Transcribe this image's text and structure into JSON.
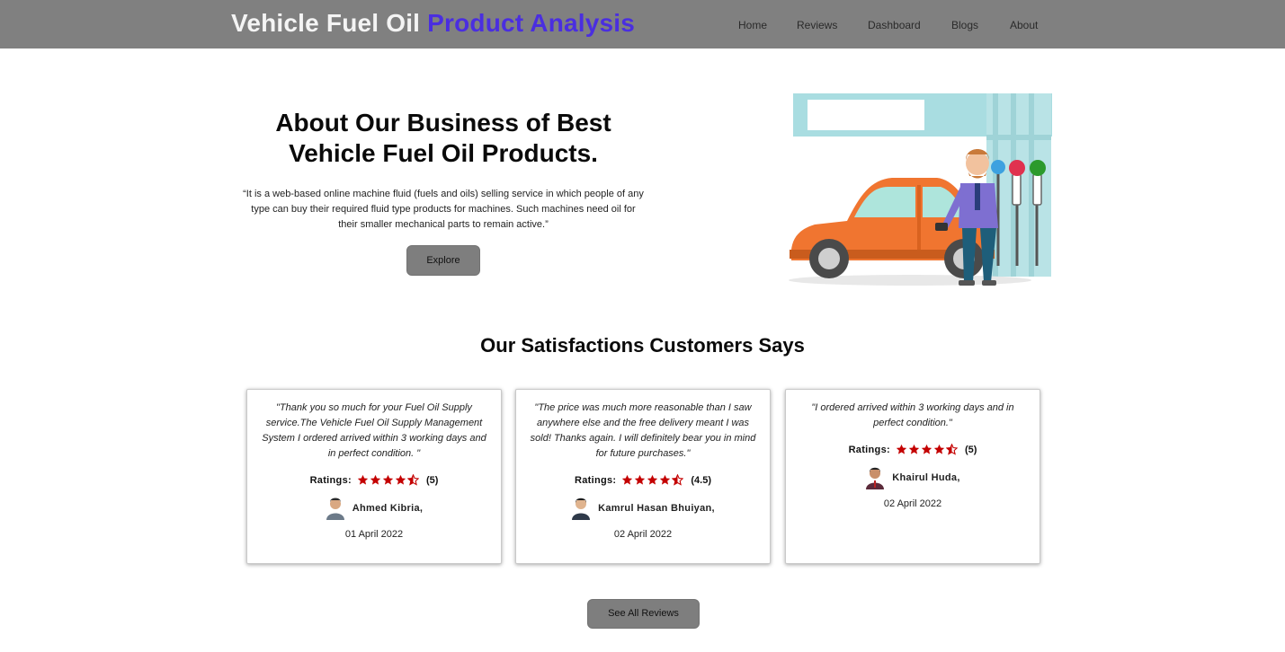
{
  "navbar": {
    "brand_part1": "Vehicle Fuel Oil",
    "brand_part2": "Product Analysis",
    "links": [
      "Home",
      "Reviews",
      "Dashboard",
      "Blogs",
      "About"
    ]
  },
  "hero": {
    "title_line1": "About Our Business of Best",
    "title_line2": "Vehicle Fuel Oil Products.",
    "description": "“It is a web-based online machine fluid (fuels and oils) selling service in which people of any type can buy their required fluid type products for machines. Such machines need oil for their smaller mechanical parts to remain active.”",
    "explore_label": "Explore",
    "illustration": "fuel-station-car-illustration"
  },
  "reviews": {
    "section_title": "Our Satisfactions Customers Says",
    "ratings_label": "Ratings:",
    "items": [
      {
        "quote": "\"Thank you so much for your Fuel Oil Supply service.The Vehicle Fuel Oil Supply Management System I ordered arrived within 3 working days and in perfect condition. \"",
        "rating_text": "(5)",
        "stars": 4.5,
        "author": "Ahmed Kibria,",
        "date": "01 April 2022"
      },
      {
        "quote": "\"The price was much more reasonable than I saw anywhere else and the free delivery meant I was sold! Thanks again. I will definitely bear you in mind for future purchases.\"",
        "rating_text": "(4.5)",
        "stars": 4.5,
        "author": "Kamrul Hasan Bhuiyan,",
        "date": "02 April 2022"
      },
      {
        "quote": "\"I ordered arrived within 3 working days and in perfect condition.\"",
        "rating_text": "(5)",
        "stars": 4.5,
        "author": "Khairul Huda,",
        "date": "02 April 2022"
      }
    ],
    "see_all_label": "See All Reviews"
  },
  "colors": {
    "navbar_bg": "#808080",
    "brand_accent": "#4a2ee0",
    "star": "#c40000",
    "button_bg": "#7e7e7e"
  }
}
